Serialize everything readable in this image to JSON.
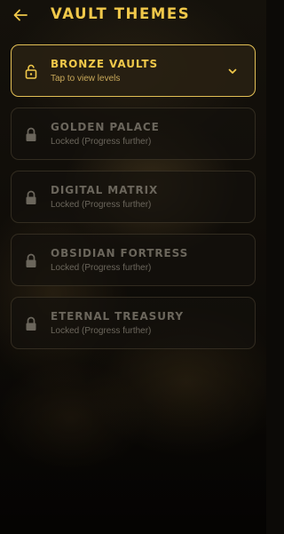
{
  "header": {
    "title": "VAULT THEMES",
    "back_icon": "arrow-left-icon"
  },
  "colors": {
    "accent": "#f0c84a",
    "locked_text": "#6b665c",
    "background": "#0c0a07"
  },
  "themes": [
    {
      "name": "BRONZE VAULTS",
      "status": "Tap to view levels",
      "state": "unlocked",
      "icon": "unlock-icon",
      "expand_icon": "chevron-down-icon"
    },
    {
      "name": "GOLDEN PALACE",
      "status": "Locked (Progress further)",
      "state": "locked",
      "icon": "lock-icon"
    },
    {
      "name": "DIGITAL MATRIX",
      "status": "Locked (Progress further)",
      "state": "locked",
      "icon": "lock-icon"
    },
    {
      "name": "OBSIDIAN FORTRESS",
      "status": "Locked (Progress further)",
      "state": "locked",
      "icon": "lock-icon"
    },
    {
      "name": "ETERNAL TREASURY",
      "status": "Locked (Progress further)",
      "state": "locked",
      "icon": "lock-icon"
    }
  ]
}
